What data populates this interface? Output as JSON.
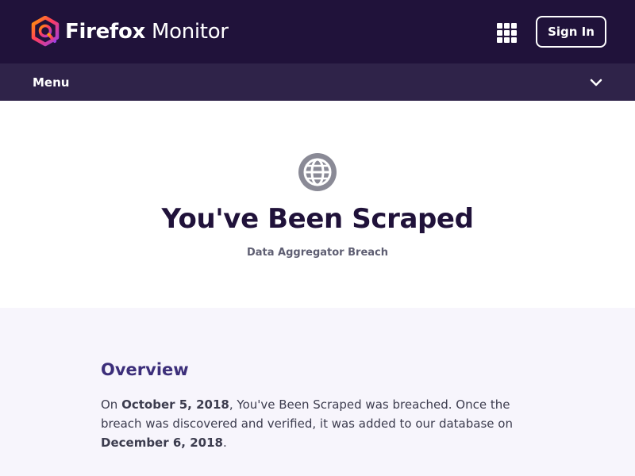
{
  "header": {
    "brand": "Firefox",
    "product": "Monitor",
    "apps_icon": "apps-grid-icon",
    "sign_in_label": "Sign In"
  },
  "menu": {
    "label": "Menu",
    "chevron_icon": "chevron-down-icon"
  },
  "hero": {
    "icon": "globe-icon",
    "title": "You've Been Scraped",
    "subtitle": "Data Aggregator Breach"
  },
  "overview": {
    "heading": "Overview",
    "p_on": "On ",
    "breach_date": "October 5, 2018",
    "p_mid": ", You've Been Scraped was breached. Once the breach was discovered and verified, it was added to our database on ",
    "added_date": "December 6, 2018",
    "p_end": "."
  },
  "colors": {
    "header_bg": "#20123a",
    "menubar_bg": "#2f2349",
    "title_text": "#20123a",
    "overview_heading": "#3c2e7a",
    "overview_bg": "#f7f5fc",
    "globe_icon": "#8a8a96"
  }
}
